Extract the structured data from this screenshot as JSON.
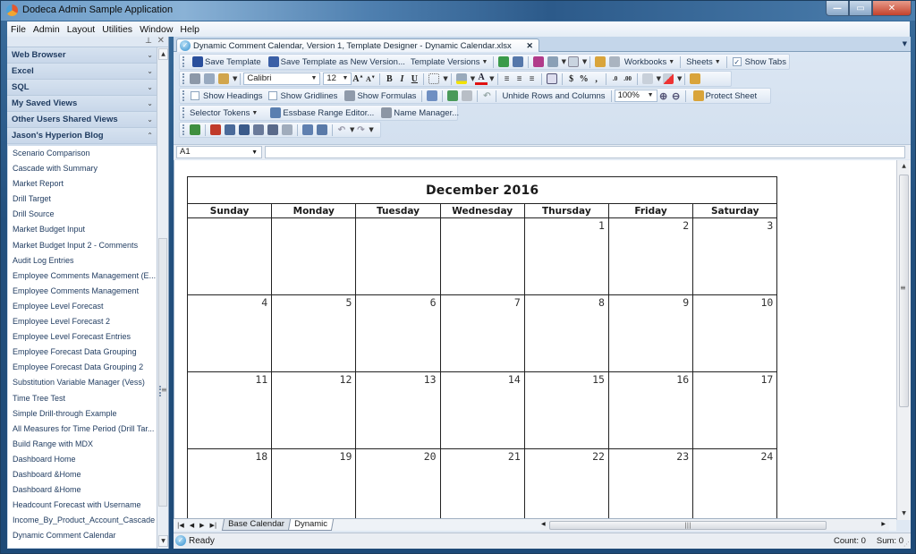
{
  "window": {
    "title": "Dodeca Admin Sample Application",
    "controls": {
      "minimize": "—",
      "maximize": "▭",
      "close": "✕"
    }
  },
  "menu": [
    "File",
    "Admin",
    "Layout",
    "Utilities",
    "Window",
    "Help"
  ],
  "sidebar": {
    "pin_icon": "⊥",
    "close_icon": "✕",
    "groups": [
      {
        "label": "Web Browser",
        "expanded": false
      },
      {
        "label": "Excel",
        "expanded": false
      },
      {
        "label": "SQL",
        "expanded": false
      },
      {
        "label": "My Saved Views",
        "expanded": false
      },
      {
        "label": "Other Users Shared Views",
        "expanded": false
      },
      {
        "label": "Jason's Hyperion Blog",
        "expanded": true
      }
    ],
    "items": [
      "Scenario Comparison",
      "Cascade with Summary",
      "Market Report",
      "Drill Target",
      "Drill Source",
      "Market Budget Input",
      "Market Budget Input 2 - Comments",
      "Audit Log Entries",
      "Employee  Comments  Management  (E...",
      "Employee Comments Management",
      "Employee Level Forecast",
      "Employee Level Forecast 2",
      "Employee Level Forecast Entries",
      "Employee Forecast Data Grouping",
      "Employee Forecast Data Grouping 2",
      "Substitution Variable Manager (Vess)",
      "Time Tree Test",
      "Simple Drill-through Example",
      "All Measures for Time Period (Drill Tar...",
      "Build Range with MDX",
      "Dashboard Home",
      "Dashboard &Home",
      "Dashboard &Home",
      "Headcount Forecast with Username",
      "Income_By_Product_Account_Cascade",
      "Dynamic Comment Calendar"
    ]
  },
  "document_tab": {
    "label": "Dynamic Comment Calendar, Version 1, Template Designer - Dynamic Calendar.xlsx",
    "close": "✕"
  },
  "toolbar": {
    "row1": {
      "save_template": "Save Template",
      "save_as_new_version": "Save Template as New Version...",
      "template_versions": "Template Versions",
      "workbooks": "Workbooks",
      "sheets": "Sheets",
      "show_tabs": "Show Tabs",
      "show_tabs_checked": true
    },
    "row2": {
      "font_name": "Calibri",
      "font_size": "12",
      "bold": "B",
      "italic": "I",
      "underline": "U",
      "currency": "$",
      "percent": "%",
      "comma": ","
    },
    "row3": {
      "show_headings": "Show Headings",
      "show_headings_checked": false,
      "show_gridlines": "Show Gridlines",
      "show_gridlines_checked": false,
      "show_formulas": "Show Formulas",
      "unhide": "Unhide Rows and Columns",
      "zoom": "100%",
      "protect_sheet": "Protect Sheet"
    },
    "row4": {
      "selector_tokens": "Selector Tokens",
      "essbase_range_editor": "Essbase Range Editor...",
      "name_manager": "Name Manager..."
    }
  },
  "formula_bar": {
    "cell_ref": "A1",
    "formula": ""
  },
  "calendar": {
    "title": "December 2016",
    "weekdays": [
      "Sunday",
      "Monday",
      "Tuesday",
      "Wednesday",
      "Thursday",
      "Friday",
      "Saturday"
    ],
    "weeks": [
      [
        "",
        "",
        "",
        "",
        "1",
        "2",
        "3"
      ],
      [
        "4",
        "5",
        "6",
        "7",
        "8",
        "9",
        "10"
      ],
      [
        "11",
        "12",
        "13",
        "14",
        "15",
        "16",
        "17"
      ],
      [
        "18",
        "19",
        "20",
        "21",
        "22",
        "23",
        "24"
      ]
    ]
  },
  "sheet_tabs": [
    {
      "label": "Base Calendar",
      "active": false
    },
    {
      "label": "Dynamic",
      "active": true
    }
  ],
  "status": {
    "text": "Ready",
    "count_label": "Count: 0",
    "sum_label": "Sum: 0"
  }
}
